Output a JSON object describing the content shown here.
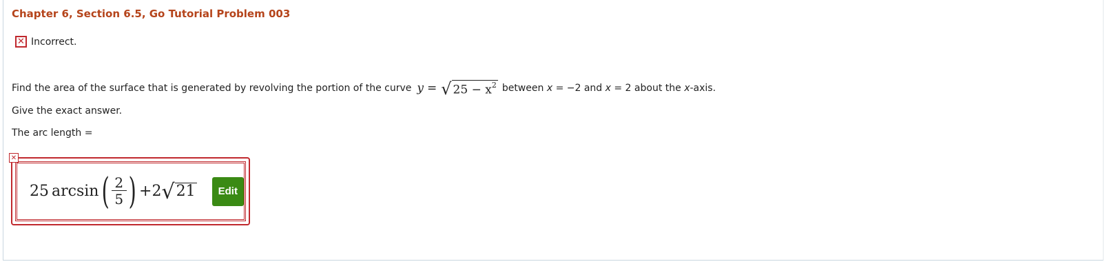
{
  "header": {
    "title": "Chapter 6, Section 6.5, Go Tutorial Problem 003"
  },
  "status": {
    "icon": "x-mark-icon",
    "text": "Incorrect.",
    "color": "#c0282d"
  },
  "question": {
    "prefix": "Find the area of the surface that is generated by revolving the portion of the curve",
    "curve": {
      "lhs": "y",
      "eq": "=",
      "radicand": "25 − x",
      "exp": "2"
    },
    "mid1": "between",
    "var1": "x",
    "cond1": "= −2 and",
    "var2": "x",
    "cond2": "= 2 about the",
    "var3": "x",
    "suffix": "-axis."
  },
  "instruction": "Give the exact answer.",
  "prompt": "The arc length =",
  "answer": {
    "coef": "25",
    "func": "arcsin",
    "frac_num": "2",
    "frac_den": "5",
    "plus": "+2",
    "radicand": "21",
    "edit_label": "Edit",
    "status_icon": "x-mark-icon"
  },
  "colors": {
    "title": "#b5441b",
    "error": "#c0282d",
    "edit_button": "#3a8a14"
  }
}
